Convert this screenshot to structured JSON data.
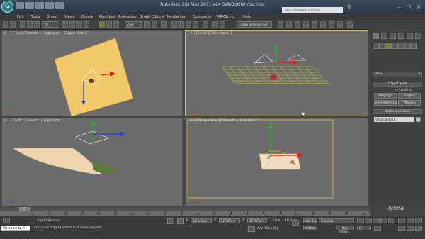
{
  "window": {
    "title": "Autodesk 3ds Max 2011 x64    SafeBottleIntro.max",
    "search_placeholder": "Type a keyword or phrase",
    "logo_letter": "G"
  },
  "menu": {
    "items": [
      "Edit",
      "Tools",
      "Group",
      "Views",
      "Create",
      "Modifiers",
      "Animation",
      "Graph Editors",
      "Rendering",
      "Customize",
      "MAXScript",
      "Help"
    ]
  },
  "toolbar": {
    "filter_label": "All",
    "coord_label": "View",
    "named_selection_placeholder": "Create Selection Set"
  },
  "viewports": {
    "top": {
      "label": "[ + ] [ Top ] [ Smooth + Highlights + Edged Faces ]"
    },
    "front": {
      "label": "[ + ] [ Front ] [ Wireframe ]"
    },
    "left": {
      "label": "[ + ] [ Left ] [ Smooth + Highlights ]"
    },
    "perspective": {
      "label": "[ + ] [ Perspective ] [ Smooth + Highlights ]"
    }
  },
  "command_panel": {
    "category": "VRay",
    "object_type_header": "Object Type",
    "autogrid_label": "AutoGrid",
    "buttons": [
      "VRayLight",
      "VRayIES",
      "vrayAmbientLig",
      "VRaySun"
    ],
    "name_color_header": "Name and Color",
    "object_name": "VRayLight001"
  },
  "timeline": {
    "slider_label": "0 / 100",
    "ticks": [
      "0",
      "5",
      "10",
      "15",
      "20",
      "25",
      "30",
      "35",
      "40",
      "45",
      "50",
      "55",
      "60",
      "65",
      "70",
      "75",
      "80",
      "85",
      "90",
      "95",
      "100"
    ]
  },
  "status": {
    "maxscript_text": "Welcome to M",
    "selection_text": "1 Light Selected",
    "prompt_text": "Click and drag to select and move objects",
    "x_label": "X:",
    "x_value": "14.549cm",
    "y_label": "Y:",
    "y_value": "32.767cm",
    "z_label": "Z:",
    "z_value": "37.787cm",
    "grid_text": "Grid = 10.0cm",
    "add_time_tag": "Add Time Tag",
    "auto_key": "Auto Key",
    "set_key": "Set Key",
    "selected_dropdown": "Selected",
    "key_filters": "Key Filters...",
    "frame_value": "0",
    "watermark": "lynda"
  },
  "colors": {
    "accent": "#d8c246",
    "viewport_bg": "#6b6b6b",
    "plane_fill": "#f2c96a",
    "gizmo_x": "#e02020",
    "gizmo_y": "#20c020",
    "gizmo_z": "#2040e0"
  }
}
